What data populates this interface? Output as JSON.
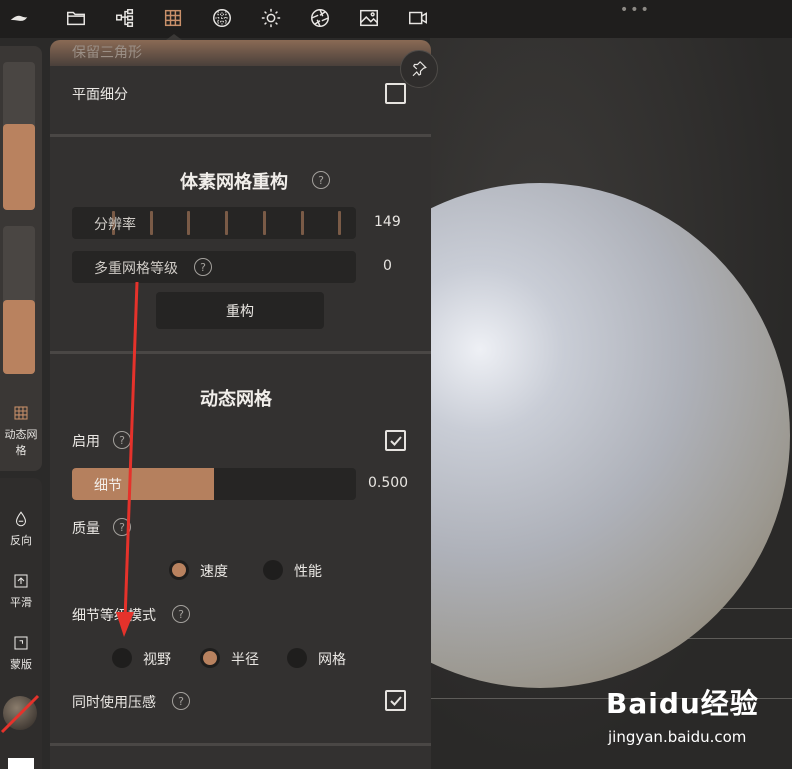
{
  "toolbar": {
    "icons": [
      "logo-icon",
      "folder-icon",
      "hierarchy-icon",
      "mesh-grid-icon",
      "sphere-dots-icon",
      "sun-icon",
      "aperture-icon",
      "image-icon",
      "video-icon"
    ],
    "more": "•••"
  },
  "left_toolbar": {
    "dynamic_mesh_label": "动态网格",
    "reverse_label": "反向",
    "smooth_label": "平滑",
    "mask_label": "蒙版"
  },
  "panel": {
    "faded_top_label": "保留三角形",
    "planar_subdivision": {
      "label": "平面细分",
      "checked": false
    },
    "voxel_section": {
      "title": "体素网格重构",
      "resolution": {
        "label": "分辨率",
        "value": "149"
      },
      "multires_level": {
        "label": "多重网格等级",
        "value": "0"
      },
      "remesh_button": "重构"
    },
    "dynamic_section": {
      "title": "动态网格",
      "enable": {
        "label": "启用",
        "checked": true
      },
      "detail": {
        "label": "细节",
        "value": "0.500",
        "fraction": 0.5
      },
      "quality": {
        "label": "质量",
        "options": [
          "速度",
          "性能"
        ],
        "selected": "速度"
      },
      "detail_mode": {
        "label": "细节等级模式",
        "options": [
          "视野",
          "半径",
          "网格"
        ],
        "selected": "半径"
      },
      "use_pressure": {
        "label": "同时使用压感",
        "checked": true
      }
    }
  },
  "help_glyph": "?",
  "watermark": {
    "brand": "Baidu经验",
    "url": "jingyan.baidu.com"
  },
  "colors": {
    "accent": "#b9825f",
    "annotation": "#e5322b"
  }
}
